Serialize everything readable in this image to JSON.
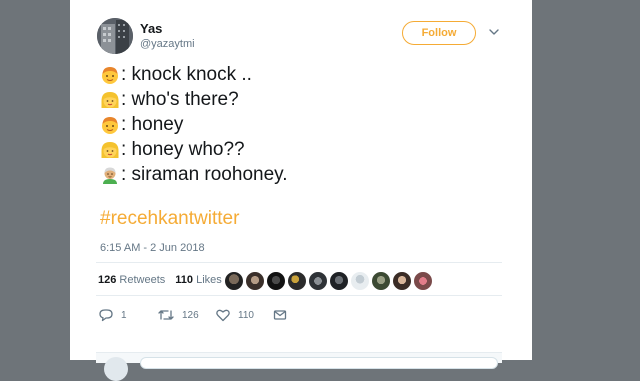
{
  "user": {
    "name": "Yas",
    "handle": "@yazaytmi"
  },
  "follow_label": "Follow",
  "tweet": {
    "lines": [
      {
        "emoji": "boy-emoji",
        "text": ": knock knock .."
      },
      {
        "emoji": "blonde-girl-emoji",
        "text": ": who's there?"
      },
      {
        "emoji": "boy-emoji",
        "text": ": honey"
      },
      {
        "emoji": "blonde-girl-emoji",
        "text": ": honey who??"
      },
      {
        "emoji": "older-man-emoji",
        "text": ": siraman roohoney."
      }
    ],
    "hashtag": "#recehkantwitter",
    "timestamp": "6:15 AM - 2 Jun 2018"
  },
  "stats": {
    "retweets_count": "126",
    "retweets_label": "Retweets",
    "likes_count": "110",
    "likes_label": "Likes"
  },
  "actions": {
    "reply_count": "1",
    "retweet_count": "126",
    "like_count": "110"
  },
  "colors": {
    "accent": "#f5ab35",
    "background": "#6e7479",
    "text": "#14171a",
    "secondary": "#657786"
  }
}
